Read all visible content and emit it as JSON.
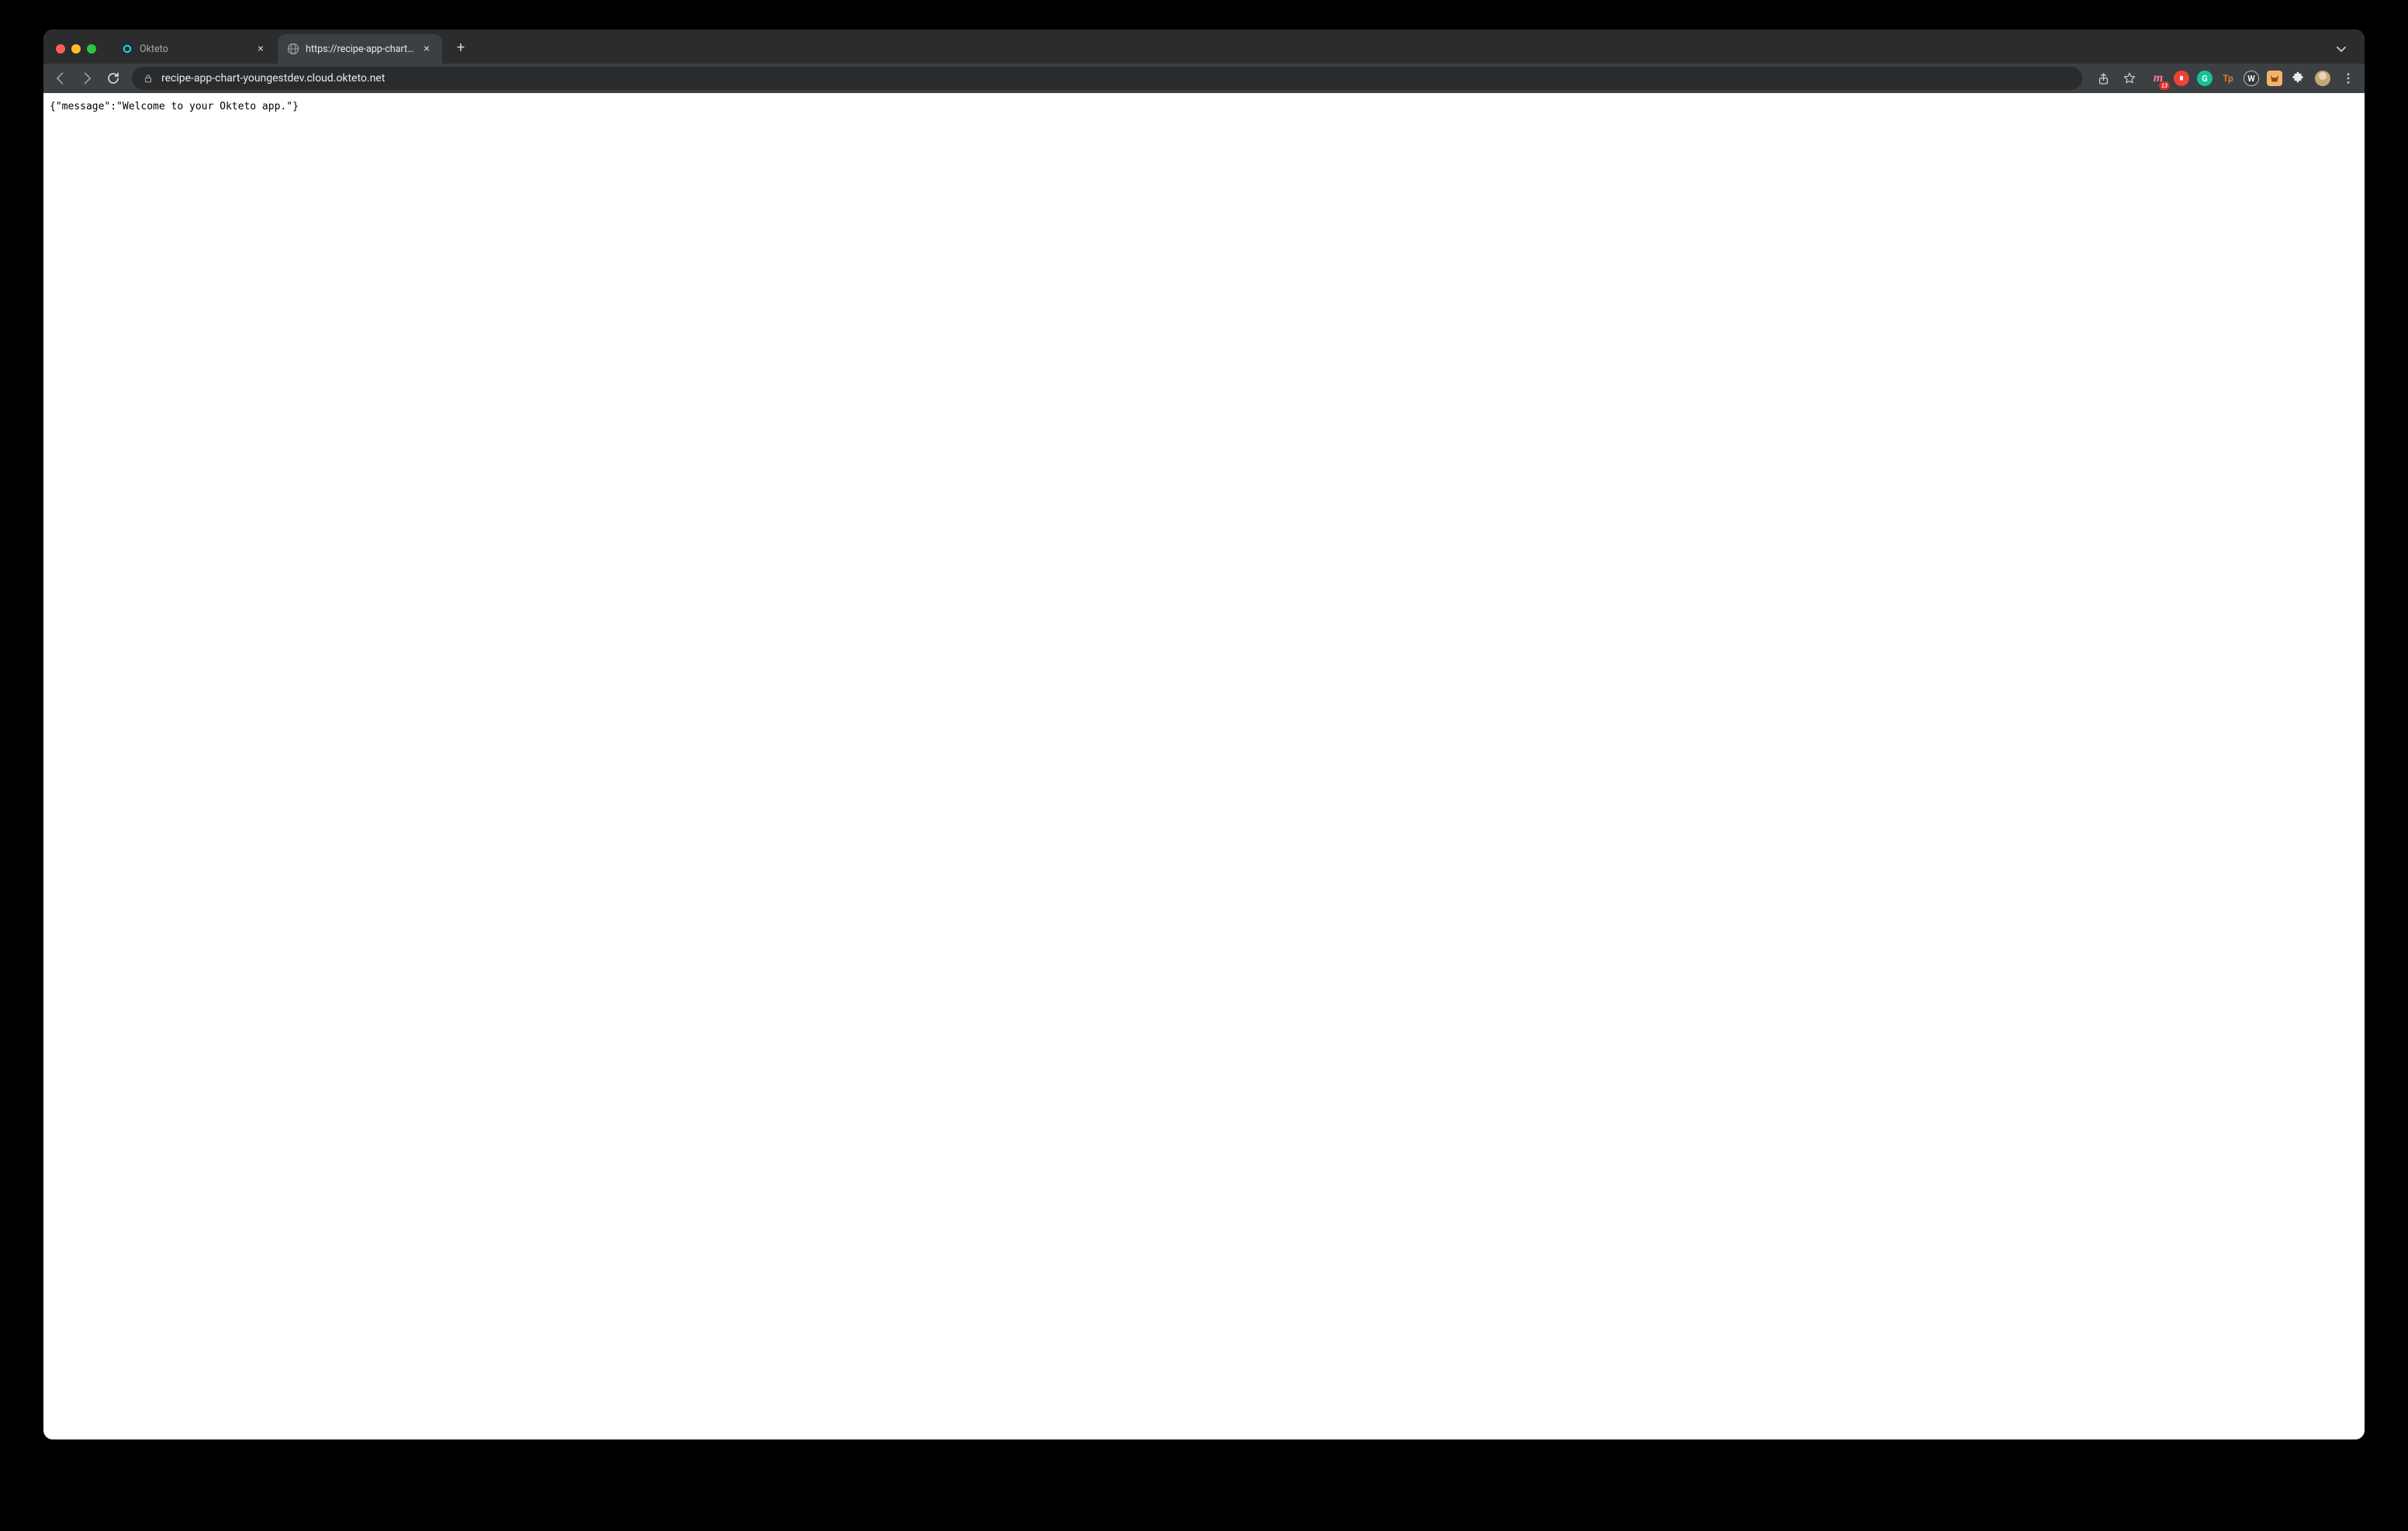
{
  "window": {
    "tabs": [
      {
        "title": "Okteto",
        "active": false
      },
      {
        "title": "https://recipe-app-chart-young",
        "active": true
      }
    ],
    "new_tab_label": "+",
    "traffic_lights": [
      "close",
      "minimize",
      "maximize"
    ]
  },
  "toolbar": {
    "url": "recipe-app-chart-youngestdev.cloud.okteto.net",
    "back_enabled": false,
    "forward_enabled": false,
    "reload_enabled": true,
    "share_icon": "share-icon",
    "star_icon": "star-icon"
  },
  "extensions": [
    {
      "name": "m13-extension",
      "label": "m",
      "color": "#ff7aa0",
      "badge": "13",
      "round": false
    },
    {
      "name": "adblock-extension",
      "label": "",
      "color": "#f04137"
    },
    {
      "name": "grammarly-extension",
      "label": "G",
      "color": "#15c39a"
    },
    {
      "name": "tp-extension",
      "label": "Tp",
      "color": "transparent",
      "text_color": "#e57a2b",
      "round": false
    },
    {
      "name": "w-extension",
      "label": "W",
      "color": "#383838",
      "border": "#bdbdbd"
    },
    {
      "name": "fox-extension",
      "label": "",
      "color": "#f5b36a"
    },
    {
      "name": "puzzle-extension",
      "label": "",
      "color": "transparent"
    }
  ],
  "profile": {
    "avatar_color": "#c4a77b"
  },
  "page": {
    "body_text": "{\"message\":\"Welcome to your Okteto app.\"}"
  }
}
